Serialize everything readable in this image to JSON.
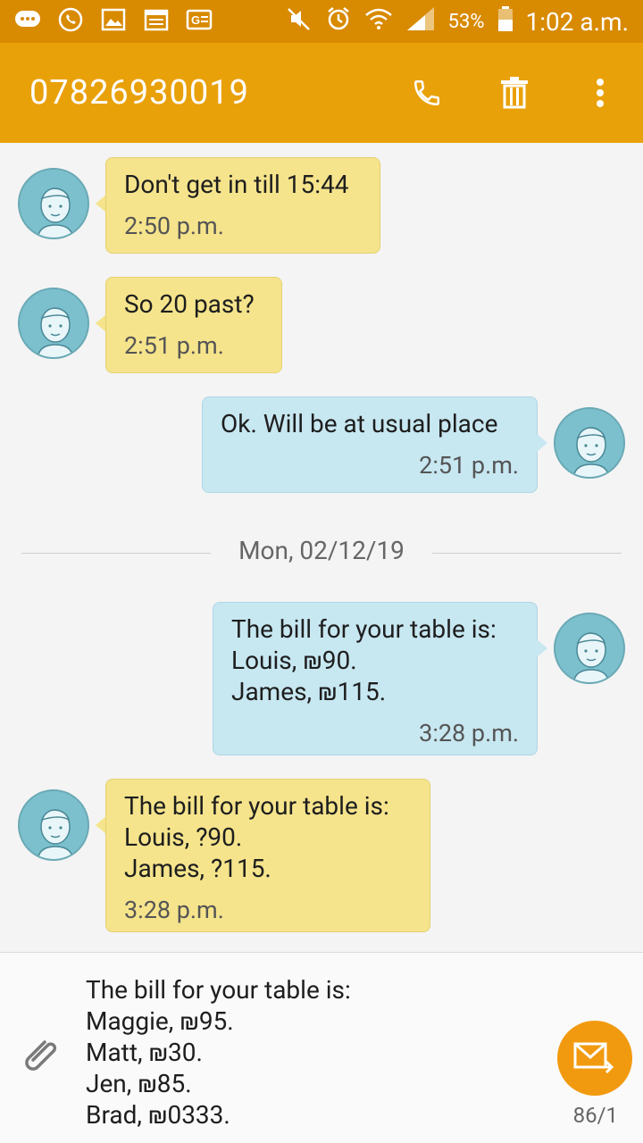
{
  "status_bar": {
    "battery": "53%",
    "time": "1:02 a.m."
  },
  "header": {
    "title": "07826930019"
  },
  "messages": [
    {
      "direction": "in",
      "text": "Don't get in till 15:44",
      "time": "2:50 p.m."
    },
    {
      "direction": "in",
      "text": "So 20 past?",
      "time": "2:51 p.m."
    },
    {
      "direction": "out",
      "text": "Ok. Will be at usual place",
      "time": "2:51 p.m."
    },
    {
      "direction": "out",
      "text": "The bill for your table is:\nLouis, ₪90.\nJames, ₪115.",
      "time": "3:28 p.m."
    },
    {
      "direction": "in",
      "text": "The bill for your table is:\nLouis, ?90.\nJames, ?115.",
      "time": "3:28 p.m."
    }
  ],
  "date_separator": "Mon, 02/12/19",
  "composer": {
    "draft": "The bill for your table is:\nMaggie, ₪95.\nMatt, ₪30.\nJen, ₪85.\nBrad, ₪0333.",
    "counter": "86/1"
  },
  "colors": {
    "status_bar": "#d88a00",
    "app_bar": "#e9a10a",
    "incoming_bubble": "#f5e48c",
    "outgoing_bubble": "#c7e7f1",
    "send_button": "#f29a0f"
  }
}
